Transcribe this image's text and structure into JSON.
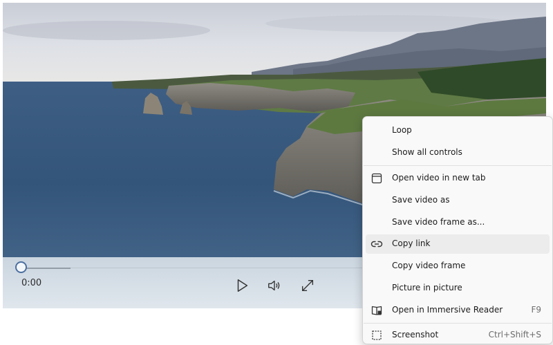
{
  "player": {
    "current_time": "0:00",
    "progress": 0,
    "controls": {
      "play_icon": "play-icon",
      "volume_icon": "volume-icon",
      "fullscreen_icon": "fullscreen-icon"
    }
  },
  "context_menu": {
    "items": [
      {
        "label": "Loop"
      },
      {
        "label": "Show all controls"
      },
      {
        "label": "Open video in new tab",
        "icon": "new-tab-icon"
      },
      {
        "label": "Save video as"
      },
      {
        "label": "Save video frame as..."
      },
      {
        "label": "Copy link",
        "icon": "link-icon",
        "highlighted": true
      },
      {
        "label": "Copy video frame"
      },
      {
        "label": "Picture in picture"
      },
      {
        "label": "Open in Immersive Reader",
        "icon": "immersive-reader-icon",
        "shortcut": "F9"
      },
      {
        "label": "Screenshot",
        "icon": "screenshot-icon",
        "shortcut": "Ctrl+Shift+S"
      }
    ]
  },
  "colors": {
    "menu_bg": "#f9f9f9",
    "menu_highlight": "#ececec",
    "seek_thumb_border": "#4b6fa0"
  }
}
